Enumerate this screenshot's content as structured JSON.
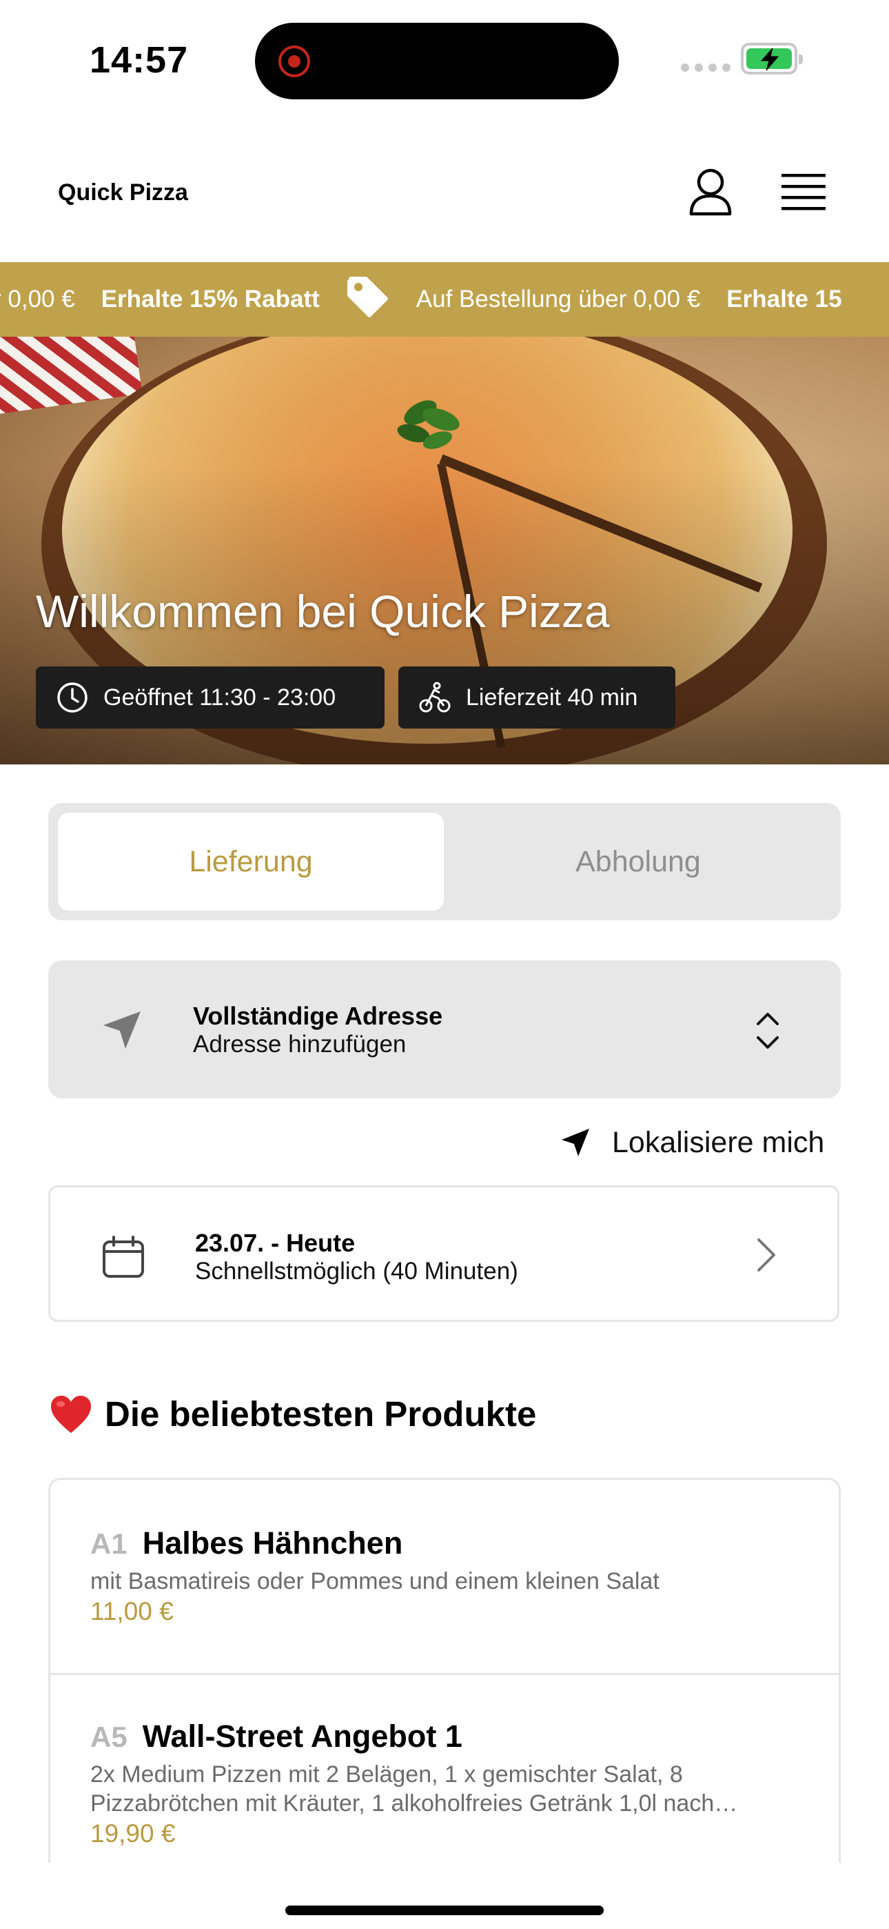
{
  "status_bar": {
    "time": "14:57"
  },
  "header": {
    "brand": "Quick Pizza"
  },
  "promo_ticker": {
    "items": [
      {
        "text": "r 0,00 €",
        "bold": false
      },
      {
        "text": "Erhalte 15% Rabatt",
        "bold": true
      },
      {
        "text": "Auf Bestellung über 0,00 €",
        "bold": false
      },
      {
        "text": "Erhalte 15",
        "bold": true
      }
    ]
  },
  "hero": {
    "title": "Willkommen bei Quick Pizza",
    "opening_hours": "Geöffnet 11:30 - 23:00",
    "delivery_time": "Lieferzeit 40 min"
  },
  "order_mode": {
    "options": [
      "Lieferung",
      "Abholung"
    ],
    "selected": "Lieferung"
  },
  "address": {
    "title": "Vollständige Adresse",
    "subtitle": "Adresse hinzufügen"
  },
  "locate_me": "Lokalisiere mich",
  "schedule": {
    "date": "23.07. - Heute",
    "time": "Schnellstmöglich (40 Minuten)"
  },
  "popular": {
    "title": "Die beliebtesten Produkte",
    "products": [
      {
        "code": "A1",
        "name": "Halbes Hähnchen",
        "description": "mit Basmatireis oder Pommes und einem kleinen Salat",
        "price": "11,00 €"
      },
      {
        "code": "A5",
        "name": "Wall-Street Angebot 1",
        "description": "2x Medium Pizzen mit 2 Belägen, 1 x gemischter Salat, 8 Pizzabrötchen mit Kräuter, 1 alkoholfreies Getränk 1,0l nach…",
        "price": "19,90 €"
      }
    ]
  },
  "colors": {
    "accent": "#bfa24b",
    "price": "#b99a3f",
    "panel": "#e7e7e7"
  }
}
